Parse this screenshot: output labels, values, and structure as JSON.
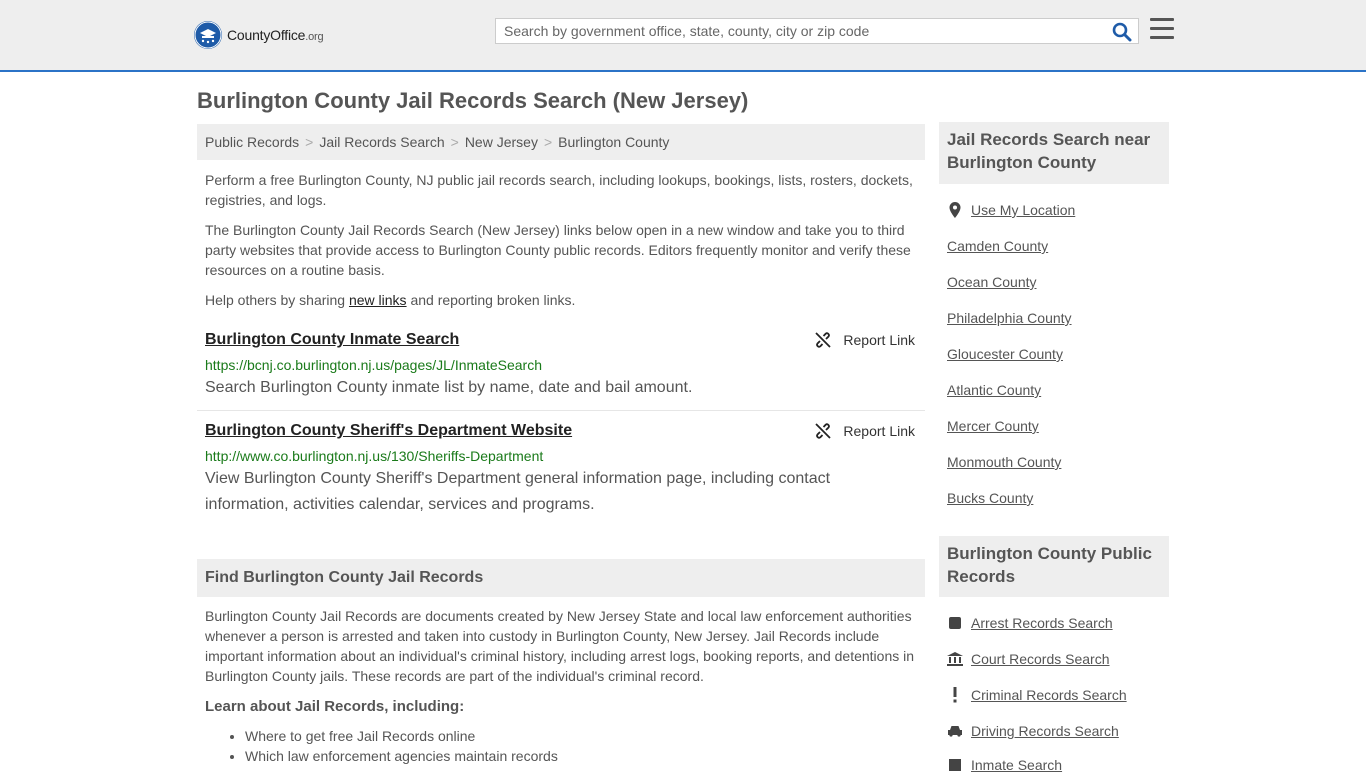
{
  "header": {
    "logo_name": "CountyOffice",
    "logo_suffix": ".org",
    "search_placeholder": "Search by government office, state, county, city or zip code"
  },
  "page": {
    "title": "Burlington County Jail Records Search (New Jersey)"
  },
  "breadcrumb": [
    "Public Records",
    "Jail Records Search",
    "New Jersey",
    "Burlington County"
  ],
  "intro": {
    "p1": "Perform a free Burlington County, NJ public jail records search, including lookups, bookings, lists, rosters, dockets, registries, and logs.",
    "p2": "The Burlington County Jail Records Search (New Jersey) links below open in a new window and take you to third party websites that provide access to Burlington County public records. Editors frequently monitor and verify these resources on a routine basis.",
    "p3_before": "Help others by sharing ",
    "p3_link": "new links",
    "p3_after": " and reporting broken links."
  },
  "results": [
    {
      "title": "Burlington County Inmate Search",
      "url": "https://bcnj.co.burlington.nj.us/pages/JL/InmateSearch",
      "desc": "Search Burlington County inmate list by name, date and bail amount.",
      "report": "Report Link"
    },
    {
      "title": "Burlington County Sheriff's Department Website",
      "url": "http://www.co.burlington.nj.us/130/Sheriffs-Department",
      "desc": "View Burlington County Sheriff's Department general information page, including contact information, activities calendar, services and programs.",
      "report": "Report Link"
    }
  ],
  "find_section": {
    "heading": "Find Burlington County Jail Records",
    "body": "Burlington County Jail Records are documents created by New Jersey State and local law enforcement authorities whenever a person is arrested and taken into custody in Burlington County, New Jersey. Jail Records include important information about an individual's criminal history, including arrest logs, booking reports, and detentions in Burlington County jails. These records are part of the individual's criminal record.",
    "learn_heading": "Learn about Jail Records, including:",
    "learn_items": [
      "Where to get free Jail Records online",
      "Which law enforcement agencies maintain records"
    ]
  },
  "sidebar": {
    "nearby_heading": "Jail Records Search near Burlington County",
    "use_location": "Use My Location",
    "nearby": [
      "Camden County",
      "Ocean County",
      "Philadelphia County",
      "Gloucester County",
      "Atlantic County",
      "Mercer County",
      "Monmouth County",
      "Bucks County"
    ],
    "public_heading": "Burlington County Public Records",
    "public_records": [
      {
        "label": "Arrest Records Search",
        "icon": "square-icon"
      },
      {
        "label": "Court Records Search",
        "icon": "courthouse-icon"
      },
      {
        "label": "Criminal Records Search",
        "icon": "exclamation-icon"
      },
      {
        "label": "Driving Records Search",
        "icon": "car-icon"
      },
      {
        "label": "Inmate Search",
        "icon": "inmate-icon"
      }
    ]
  },
  "colors": {
    "accent_blue": "#2b73c7",
    "url_green": "#1a7a1a",
    "header_bg": "#eeeeee"
  }
}
